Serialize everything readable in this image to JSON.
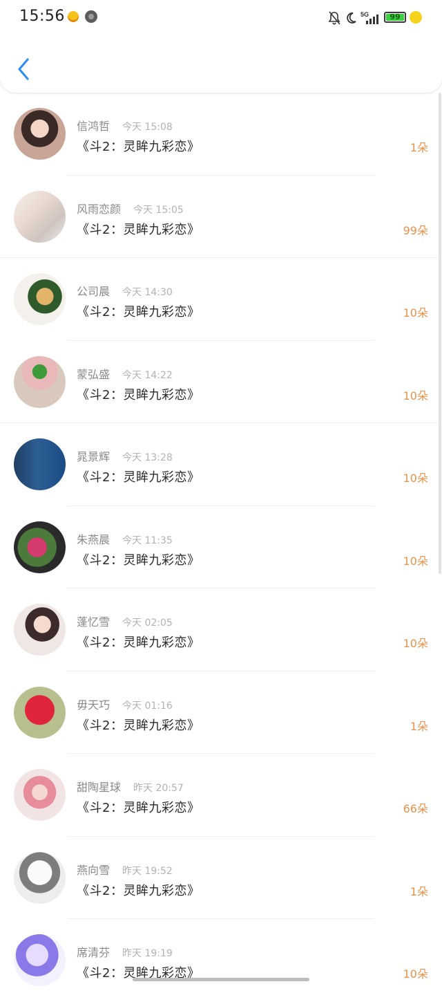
{
  "status_bar": {
    "time": "15:56",
    "battery": "99"
  },
  "colors": {
    "accent": "#2f8ff0",
    "count": "#e8924a"
  },
  "icons": [
    "back-icon",
    "bell-off-icon",
    "moon-icon",
    "signal-icon",
    "battery-icon",
    "charging-icon"
  ],
  "rows": [
    {
      "name": "信鸿哲",
      "time": "今天 15:08",
      "title": "《斗2：灵眸九彩恋》",
      "count": "1朵"
    },
    {
      "name": "风雨恋颜",
      "time": "今天 15:05",
      "title": "《斗2：灵眸九彩恋》",
      "count": "99朵"
    },
    {
      "name": "公司晨",
      "time": "今天 14:30",
      "title": "《斗2：灵眸九彩恋》",
      "count": "10朵"
    },
    {
      "name": "蒙弘盛",
      "time": "今天 14:22",
      "title": "《斗2：灵眸九彩恋》",
      "count": "10朵"
    },
    {
      "name": "晁景辉",
      "time": "今天 13:28",
      "title": "《斗2：灵眸九彩恋》",
      "count": "10朵"
    },
    {
      "name": "朱燕晨",
      "time": "今天 11:35",
      "title": "《斗2：灵眸九彩恋》",
      "count": "10朵"
    },
    {
      "name": "蓬忆雪",
      "time": "今天 02:05",
      "title": "《斗2：灵眸九彩恋》",
      "count": "10朵"
    },
    {
      "name": "毋天巧",
      "time": "今天 01:16",
      "title": "《斗2：灵眸九彩恋》",
      "count": "1朵"
    },
    {
      "name": "甜陶星球",
      "time": "昨天 20:57",
      "title": "《斗2：灵眸九彩恋》",
      "count": "66朵"
    },
    {
      "name": "燕向雪",
      "time": "昨天 19:52",
      "title": "《斗2：灵眸九彩恋》",
      "count": "1朵"
    },
    {
      "name": "席清芬",
      "time": "昨天 19:19",
      "title": "《斗2：灵眸九彩恋》",
      "count": "10朵"
    }
  ]
}
